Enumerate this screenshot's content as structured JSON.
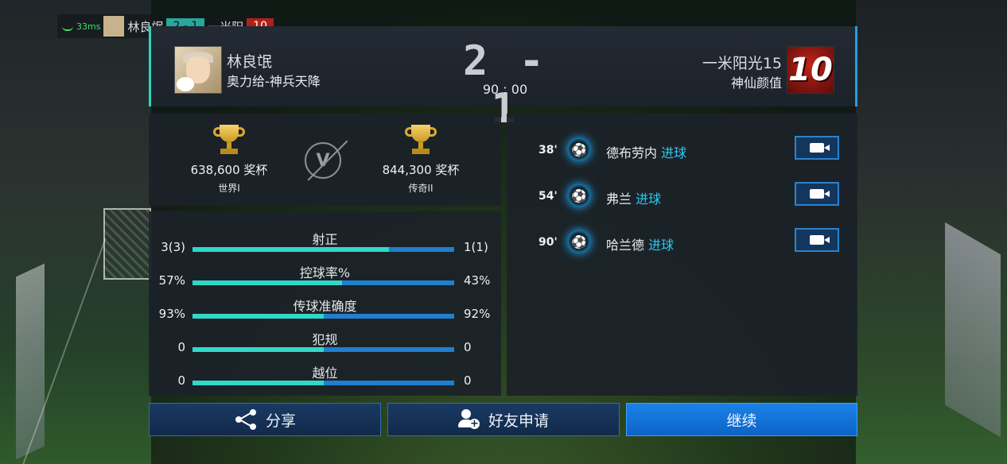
{
  "mini_hud": {
    "ping": "33ms",
    "player_name": "林良氓",
    "score": "2 - 1",
    "opponent_name": "一米阳",
    "opponent_badge": "10"
  },
  "header": {
    "home": {
      "name": "林良氓",
      "club": "奥力给-神兵天降"
    },
    "away": {
      "name": "一米阳光15",
      "club": "神仙颜值",
      "badge": "10"
    },
    "score": "2 - 1",
    "time": "90 : 00"
  },
  "trophies": {
    "home": {
      "points": "638,600 奖杯",
      "rank": "世界I"
    },
    "vs": "V",
    "away": {
      "points": "844,300 奖杯",
      "rank": "传奇II"
    }
  },
  "stats": [
    {
      "label": "射正",
      "home": "3(3)",
      "away": "1(1)",
      "home_share": 0.75
    },
    {
      "label": "控球率%",
      "home": "57%",
      "away": "43%",
      "home_share": 0.57
    },
    {
      "label": "传球准确度",
      "home": "93%",
      "away": "92%",
      "home_share": 0.503
    },
    {
      "label": "犯规",
      "home": "0",
      "away": "0",
      "home_share": 0.5
    },
    {
      "label": "越位",
      "home": "0",
      "away": "0",
      "home_share": 0.5
    }
  ],
  "events": [
    {
      "minute": "38'",
      "player": "德布劳内",
      "type": "进球"
    },
    {
      "minute": "54'",
      "player": "弗兰",
      "type": "进球"
    },
    {
      "minute": "90'",
      "player": "哈兰德",
      "type": "进球"
    }
  ],
  "buttons": {
    "share": "分享",
    "friend": "好友申请",
    "continue": "继续"
  },
  "colors": {
    "accent_teal": "#31d8c8",
    "accent_blue": "#1f7fd0",
    "event_text": "#2cc8f0"
  }
}
